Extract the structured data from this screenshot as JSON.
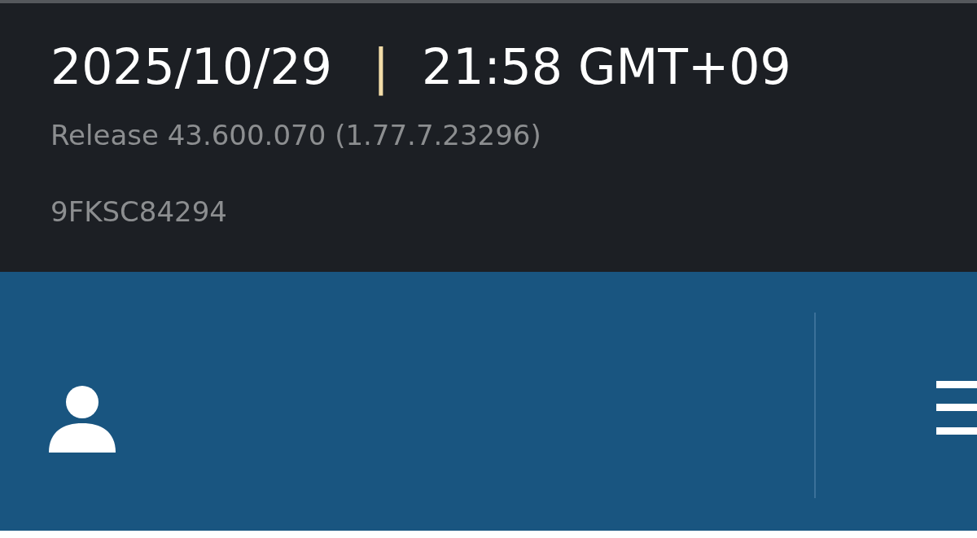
{
  "header": {
    "date": "2025/10/29",
    "separator": "|",
    "time": "21:58 GMT+09",
    "release": "Release 43.600.070 (1.77.7.23296)",
    "serial": "9FKSC84294"
  }
}
